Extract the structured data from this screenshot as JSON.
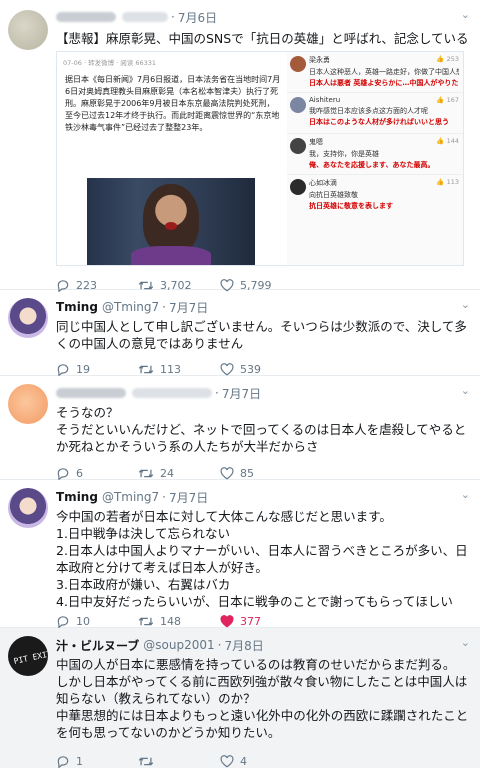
{
  "tweets": [
    {
      "user": {
        "name": "Kobas",
        "handle": "",
        "blurred": true
      },
      "date": "7月6日",
      "text": "【悲報】麻原彰晃、中国のSNSで「抗日の英雄」と呼ばれ、記念している",
      "embed": {
        "meta": "07-06 · 转发微博 · 阅读 66331",
        "article": "据日本《每日新闻》7月6日报道，日本法务省在当地时间7月6日对奥姆真理教头目麻原彰晃（本名松本智津夫）执行了死刑。麻原彰晃于2006年9月被日本东京最高法院判处死刑，至今已过去12年才终于执行。而此时距离震惊世界的“东京地铁沙林毒气事件”已经过去了整整23年。",
        "comments": [
          {
            "name": "梁永勇",
            "likes": "253",
            "zh": "日本人这种恶人，英雄一路走好，你做了中国人想做的事情，太给力",
            "jp": "日本人は悪者 英雄よ安らかに…中国人がやりたいことをしました。あなたに「いいね」！"
          },
          {
            "name": "Aishiteru",
            "likes": "167",
            "zh": "我咋感觉日本应该多点这方面的人才呢",
            "jp": "日本はこのような人材が多ければいいと思う"
          },
          {
            "name": "鬼嗯",
            "likes": "144",
            "zh": "我，支持你，你是英雄",
            "jp": "俺、あなたを応援します、あなた最高。"
          },
          {
            "name": "心如冰滴",
            "likes": "113",
            "zh": "向抗日英雄致敬",
            "jp": "抗日英雄に敬意を表します"
          }
        ]
      },
      "actions": {
        "reply": "223",
        "retweet": "3,702",
        "like": "5,799",
        "liked": false
      }
    },
    {
      "user": {
        "name": "Tming",
        "handle": "@Tming7",
        "blurred": false
      },
      "date": "7月7日",
      "text": "同じ中国人として申し訳ございません。そいつらは少数派ので、決して多くの中国人の意見ではありません",
      "actions": {
        "reply": "19",
        "retweet": "113",
        "like": "539",
        "liked": false
      }
    },
    {
      "user": {
        "name": "",
        "handle": "",
        "blurred": true
      },
      "date": "7月7日",
      "text": "そうなの？\nそうだといいんだけど、ネットで回ってくるのは日本人を虐殺してやるとか死ねとかそういう系の人たちが大半だからさ",
      "actions": {
        "reply": "6",
        "retweet": "24",
        "like": "85",
        "liked": false
      }
    },
    {
      "user": {
        "name": "Tming",
        "handle": "@Tming7",
        "blurred": false
      },
      "date": "7月7日",
      "text": "今中国の若者が日本に対して大体こんな感じだと思います。\n1.日中戦争は決して忘られない\n2.日本人は中国人よりマナーがいい、日本人に習うべきところが多い、日本政府と分けて考えば日本人が好き。\n3.日本政府が嫌い、右翼はバカ\n4.日中友好だったらいいが、日本に戦争のことで謝ってもらってほしい",
      "actions": {
        "reply": "10",
        "retweet": "148",
        "like": "377",
        "liked": true
      }
    },
    {
      "user": {
        "name": "汁・ビルヌーブ",
        "handle": "@soup2001",
        "blurred": false
      },
      "date": "7月8日",
      "text": "中国の人が日本に悪感情を持っているのは教育のせいだからまだ判る。\nしかし日本がやってくる前に西欧列強が散々食い物にしたことは中国人は知らない（教えられてない）のか？\n中華思想的には日本よりもっと遠い化外中の化外の西欧に蹂躙されたことを何も思ってないのかどうか知りたい。",
      "actions": {
        "reply": "1",
        "retweet": "",
        "like": "4",
        "liked": false
      }
    }
  ],
  "colors": {
    "like_active": "#e0245e",
    "muted": "#657786",
    "annotation_red": "#d40000"
  },
  "icons": [
    "chevron-down-icon",
    "reply-icon",
    "retweet-icon",
    "like-icon"
  ]
}
